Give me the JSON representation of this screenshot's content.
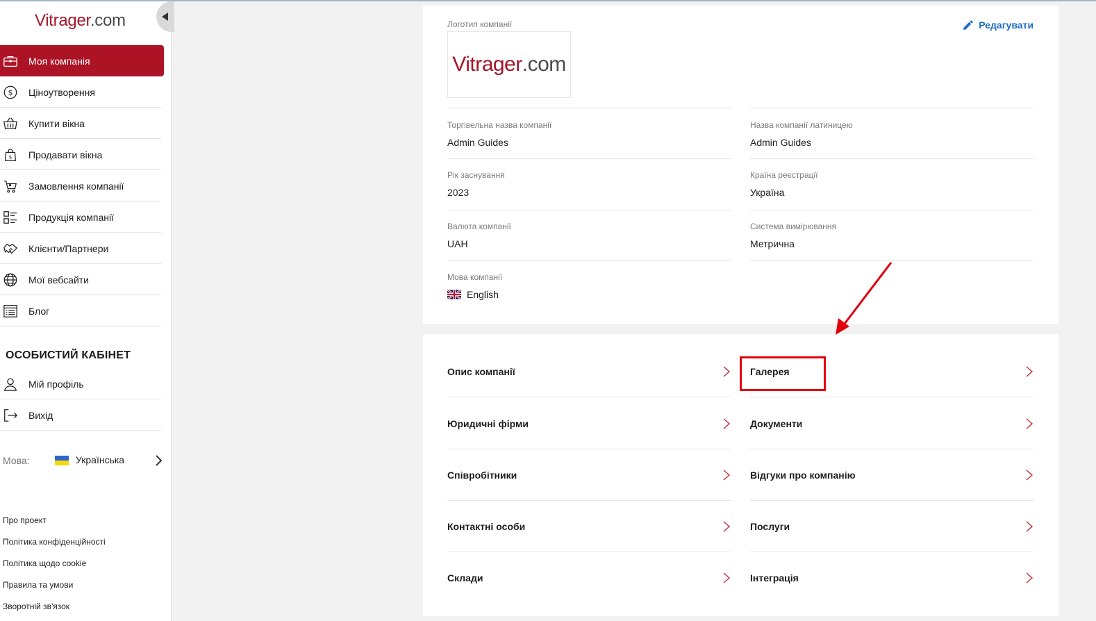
{
  "sidebar": {
    "logo_brand": "Vitrager",
    "logo_tld": ".com",
    "items": [
      {
        "label": "Моя компанія",
        "icon": "briefcase-icon",
        "active": true
      },
      {
        "label": "Ціноутворення",
        "icon": "dollar-coin-icon"
      },
      {
        "label": "Купити вікна",
        "icon": "basket-icon"
      },
      {
        "label": "Продавати вікна",
        "icon": "shopping-bag-icon"
      },
      {
        "label": "Замовлення компанії",
        "icon": "cart-icon"
      },
      {
        "label": "Продукція компанії",
        "icon": "list-grid-icon"
      },
      {
        "label": "Клієнти/Партнери",
        "icon": "handshake-icon"
      },
      {
        "label": "Мої вебсайти",
        "icon": "globe-icon"
      },
      {
        "label": "Блог",
        "icon": "blog-icon"
      }
    ],
    "section_title": "ОСОБИСТИЙ КАБІНЕТ",
    "personal_items": [
      {
        "label": "Мій профіль",
        "icon": "user-icon"
      },
      {
        "label": "Вихід",
        "icon": "logout-icon"
      }
    ],
    "language": {
      "label": "Мова:",
      "value": "Українська"
    },
    "footer_links": [
      "Про проект",
      "Політика конфіденційності",
      "Політика щодо cookie",
      "Правила та умови",
      "Зворотній зв'язок"
    ]
  },
  "company": {
    "edit_label": "Редагувати",
    "logo_label": "Логотип компанії",
    "logo_brand": "Vitrager",
    "logo_tld": ".com",
    "fields": {
      "trade_name": {
        "label": "Торгівельна назва компанії",
        "value": "Admin Guides"
      },
      "latin_name": {
        "label": "Назва компанії латиницею",
        "value": "Admin Guides"
      },
      "founded": {
        "label": "Рік заснування",
        "value": "2023"
      },
      "country": {
        "label": "Країна реєстрації",
        "value": "Україна"
      },
      "currency": {
        "label": "Валюта компанії",
        "value": "UAH"
      },
      "measure": {
        "label": "Система вимірювання",
        "value": "Метрична"
      },
      "language": {
        "label": "Мова компанії",
        "value": "English"
      }
    }
  },
  "sections": {
    "left": [
      "Опис компанії",
      "Юридичні фірми",
      "Співробітники",
      "Контактні особи",
      "Склади"
    ],
    "right": [
      "Галерея",
      "Документи",
      "Відгуки про компанію",
      "Послуги",
      "Інтеграція"
    ]
  },
  "colors": {
    "accent": "#ac1426",
    "link": "#1f6fc1",
    "highlight": "#e3000f"
  }
}
